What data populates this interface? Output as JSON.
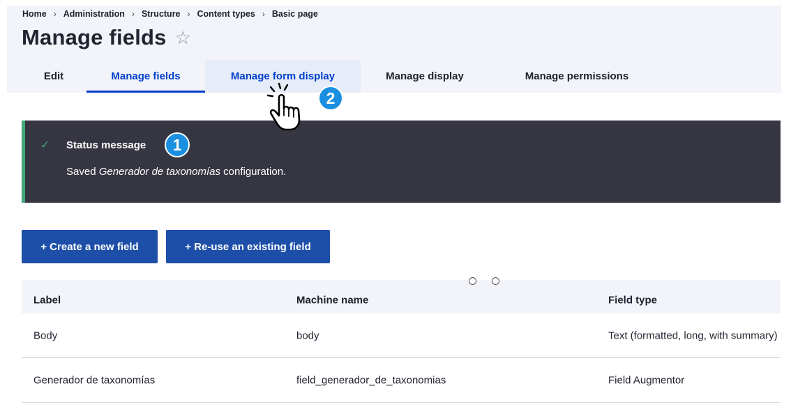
{
  "breadcrumb": [
    "Home",
    "Administration",
    "Structure",
    "Content types",
    "Basic page"
  ],
  "breadcrumb_separator": "›",
  "page_title": "Manage fields",
  "tabs": [
    "Edit",
    "Manage fields",
    "Manage form display",
    "Manage display",
    "Manage permissions"
  ],
  "status": {
    "title": "Status message",
    "text_before": "Saved ",
    "text_em": "Generador de taxonomías",
    "text_after": " configuration."
  },
  "badges": [
    "1",
    "2"
  ],
  "buttons": {
    "create": "+ Create a new field",
    "reuse": "+ Re-use an existing field"
  },
  "table": {
    "headers": [
      "Label",
      "Machine name",
      "Field type"
    ],
    "rows": [
      [
        "Body",
        "body",
        "Text (formatted, long, with summary)"
      ],
      [
        "Generador de taxonomías",
        "field_generador_de_taxonomias",
        "Field Augmentor"
      ]
    ]
  },
  "icons": {
    "check": "✓",
    "star": "☆"
  },
  "colors": {
    "accent": "#003ecc",
    "button": "#1e4fa8",
    "status_bg": "#353641",
    "status_border": "#42a877",
    "badge": "#1b8fe0"
  }
}
